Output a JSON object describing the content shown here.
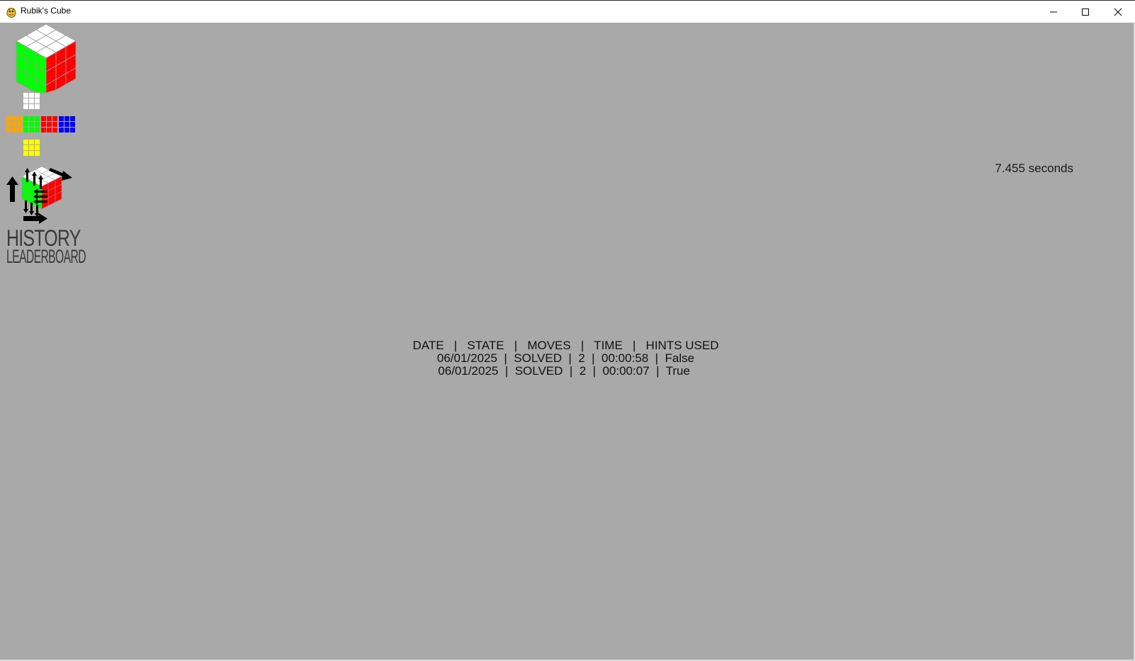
{
  "window": {
    "title": "Rubik's Cube",
    "icon": "pygame-snake-icon",
    "controls": [
      "minimize-icon",
      "maximize-icon",
      "close-icon"
    ]
  },
  "sidebar": {
    "items": [
      {
        "name": "cube-3d-view",
        "icon": "rubiks-cube-3d-icon"
      },
      {
        "name": "cube-net-view",
        "icon": "cube-net-icon"
      },
      {
        "name": "cube-moves-view",
        "icon": "cube-moves-arrows-icon"
      },
      {
        "label": "HISTORY"
      },
      {
        "label": "LEADERBOARD"
      }
    ]
  },
  "timer": {
    "text": "7.455 seconds"
  },
  "history": {
    "header": "DATE   |   STATE   |   MOVES   |   TIME   |   HINTS USED",
    "rows": [
      "06/01/2025  |  SOLVED  |  2  |  00:00:58  |  False",
      "06/01/2025  |  SOLVED  |  2  |  00:00:07  |  True "
    ]
  },
  "colors": {
    "background": "#a9a9a9",
    "white": "#ffffff",
    "green": "#00ff00",
    "red": "#ff0000",
    "orange": "#ffa500",
    "blue": "#0000ff",
    "yellow": "#ffff00"
  }
}
